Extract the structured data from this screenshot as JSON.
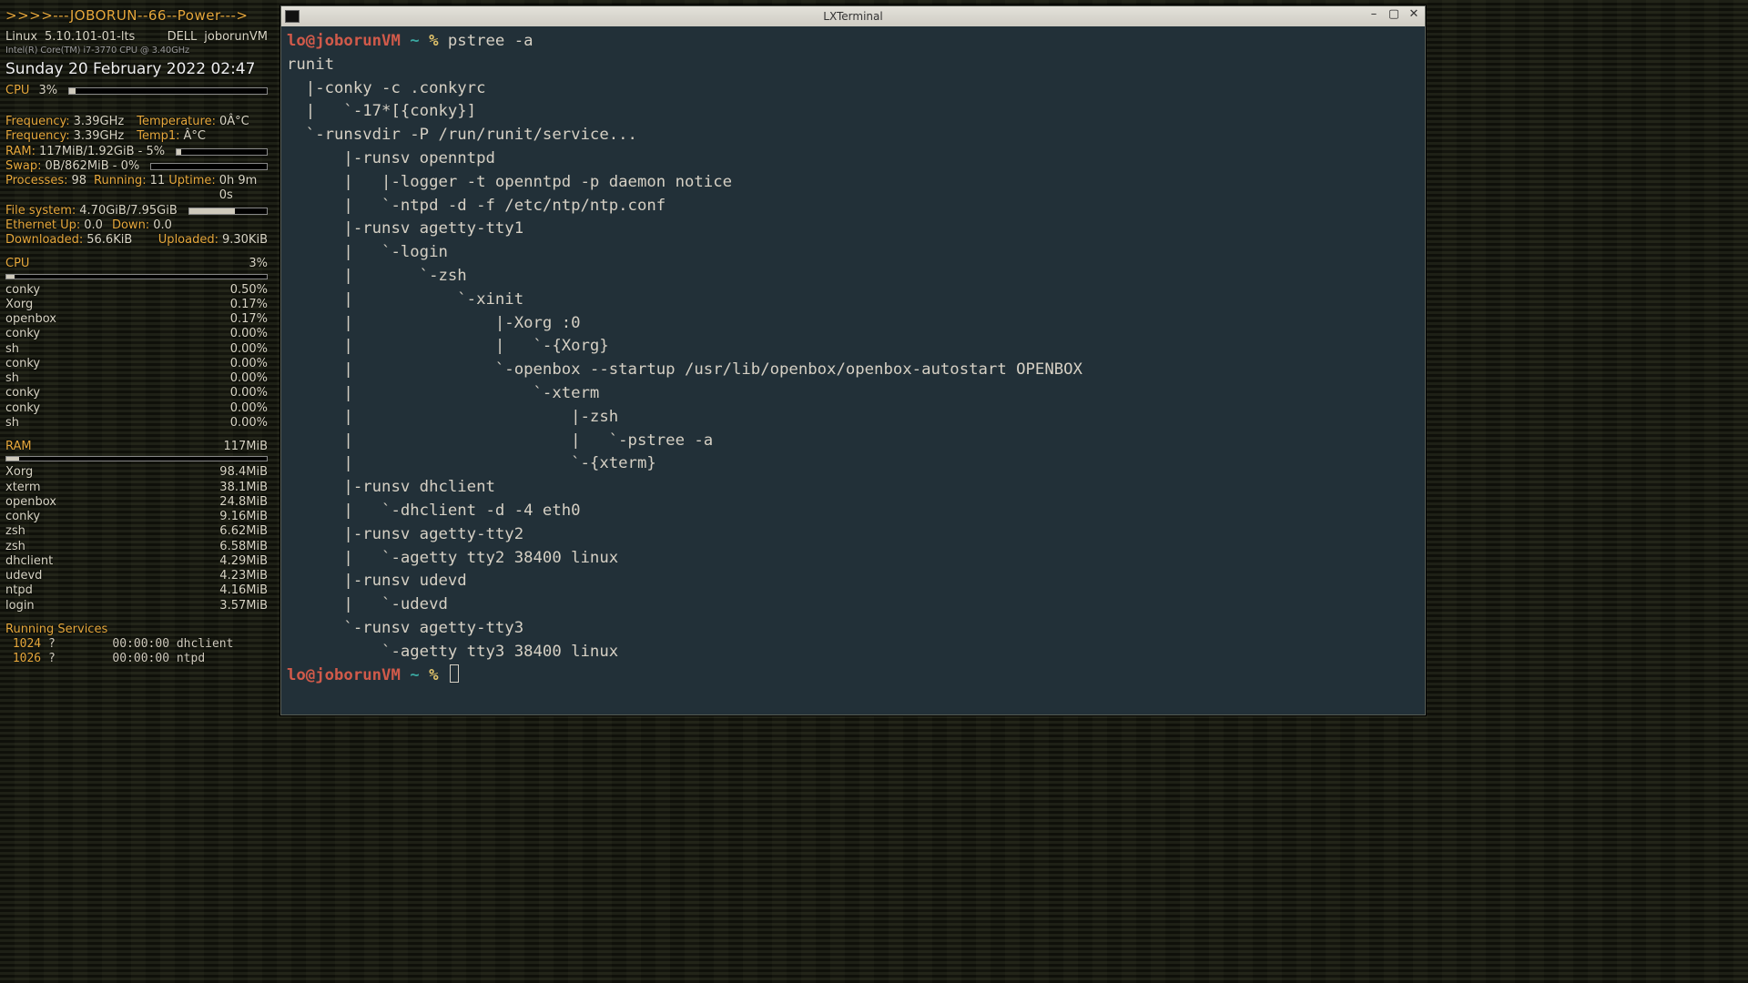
{
  "conky": {
    "title": ">>>>---JOBORUN--66--Power--->",
    "kernel_label": "Linux",
    "kernel_value": "5.10.101-01-lts",
    "host_label": "DELL",
    "host_value": "joborunVM",
    "cpuinfo": "Intel(R) Core(TM) i7-3770 CPU @ 3.40GHz",
    "datetime": "Sunday 20 February 2022  02:47",
    "cpu_label": "CPU",
    "cpu_pct": "3%",
    "cpu_bar_pct": 3,
    "freq_label": "Frequency:",
    "freq_value": "3.39GHz",
    "temp_label": "Temperature:",
    "temp_value": "0Â°C",
    "temp1_label": "Temp1:",
    "temp1_value": "Â°C",
    "ram_label": "RAM:",
    "ram_value": "117MiB/1.92GiB - 5%",
    "ram_bar_pct": 5,
    "swap_label": "Swap:",
    "swap_value": "0B/862MiB - 0%",
    "swap_bar_pct": 0,
    "proc_label": "Processes:",
    "proc_value": "98",
    "run_label": "Running:",
    "run_value": "11",
    "uptime_label": "Uptime:",
    "uptime_value": "0h 9m 0s",
    "fs_label": "File system:",
    "fs_value": "4.70GiB/7.95GiB",
    "fs_bar_pct": 59,
    "ethup_label": "Ethernet Up:",
    "ethup_value": "0.0",
    "ethdn_label": "Down:",
    "ethdn_value": "0.0",
    "dl_label": "Downloaded:",
    "dl_value": "56.6KiB",
    "ul_label": "Uploaded:",
    "ul_value": "9.30KiB",
    "cpu_section": "CPU",
    "cpu_section_pct": "3%",
    "cpu_section_bar": 3,
    "cpu_procs": [
      {
        "name": "conky",
        "pct": "0.50%"
      },
      {
        "name": "Xorg",
        "pct": "0.17%"
      },
      {
        "name": "openbox",
        "pct": "0.17%"
      },
      {
        "name": "conky",
        "pct": "0.00%"
      },
      {
        "name": "sh",
        "pct": "0.00%"
      },
      {
        "name": "conky",
        "pct": "0.00%"
      },
      {
        "name": "sh",
        "pct": "0.00%"
      },
      {
        "name": "conky",
        "pct": "0.00%"
      },
      {
        "name": "conky",
        "pct": "0.00%"
      },
      {
        "name": "sh",
        "pct": "0.00%"
      }
    ],
    "ram_section": "RAM",
    "ram_section_val": "117MiB",
    "ram_section_bar": 5,
    "ram_procs": [
      {
        "name": "Xorg",
        "val": "98.4MiB"
      },
      {
        "name": "xterm",
        "val": "38.1MiB"
      },
      {
        "name": "openbox",
        "val": "24.8MiB"
      },
      {
        "name": "conky",
        "val": "9.16MiB"
      },
      {
        "name": "zsh",
        "val": "6.62MiB"
      },
      {
        "name": "zsh",
        "val": "6.58MiB"
      },
      {
        "name": "dhclient",
        "val": "4.29MiB"
      },
      {
        "name": "udevd",
        "val": "4.23MiB"
      },
      {
        "name": "ntpd",
        "val": "4.16MiB"
      },
      {
        "name": "login",
        "val": "3.57MiB"
      }
    ],
    "services_label": "Running Services",
    "services": [
      {
        "pid": "1024",
        "tty": "?",
        "time": "00:00:00",
        "name": "dhclient"
      },
      {
        "pid": "1026",
        "tty": "?",
        "time": "00:00:00",
        "name": "ntpd"
      }
    ]
  },
  "terminal": {
    "window_title": "LXTerminal",
    "prompt_user": "lo@joborunVM",
    "prompt_path": "~",
    "prompt_symbol": "%",
    "command": "pstree -a",
    "tree": [
      "runit",
      "  |-conky -c .conkyrc",
      "  |   `-17*[{conky}]",
      "  `-runsvdir -P /run/runit/service...",
      "      |-runsv openntpd",
      "      |   |-logger -t openntpd -p daemon notice",
      "      |   `-ntpd -d -f /etc/ntp/ntp.conf",
      "      |-runsv agetty-tty1",
      "      |   `-login",
      "      |       `-zsh",
      "      |           `-xinit",
      "      |               |-Xorg :0",
      "      |               |   `-{Xorg}",
      "      |               `-openbox --startup /usr/lib/openbox/openbox-autostart OPENBOX",
      "      |                   `-xterm",
      "      |                       |-zsh",
      "      |                       |   `-pstree -a",
      "      |                       `-{xterm}",
      "      |-runsv dhclient",
      "      |   `-dhclient -d -4 eth0",
      "      |-runsv agetty-tty2",
      "      |   `-agetty tty2 38400 linux",
      "      |-runsv udevd",
      "      |   `-udevd",
      "      `-runsv agetty-tty3",
      "          `-agetty tty3 38400 linux"
    ]
  }
}
